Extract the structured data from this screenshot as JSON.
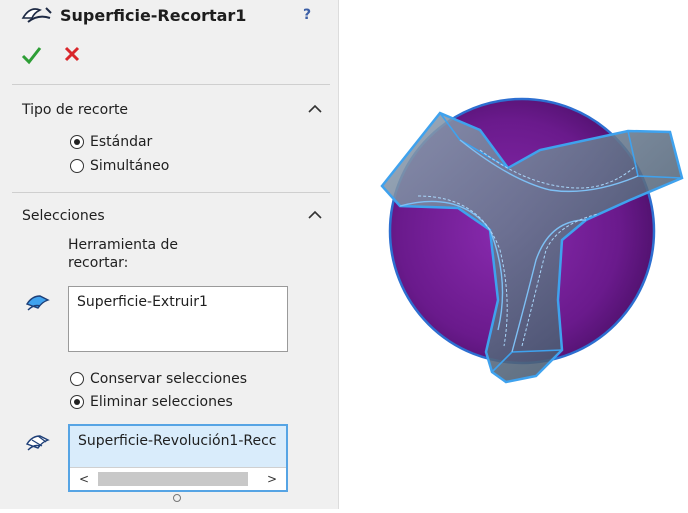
{
  "feature": {
    "title": "Superficie-Recortar1",
    "help_label": "?"
  },
  "trim_type": {
    "heading": "Tipo de recorte",
    "options": [
      {
        "label": "Estándar",
        "selected": true
      },
      {
        "label": "Simultáneo",
        "selected": false
      }
    ]
  },
  "selections": {
    "heading": "Selecciones",
    "trim_tool_label": "Herramienta de recortar:",
    "trim_tool_value": "Superficie-Extruir1",
    "options": [
      {
        "label": "Conservar selecciones",
        "selected": false
      },
      {
        "label": "Eliminar selecciones",
        "selected": true
      }
    ],
    "pieces_value": "Superficie-Revolución1-Recc",
    "scroll_left": "<",
    "scroll_right": ">"
  },
  "colors": {
    "ok": "#2e9e36",
    "cancel": "#d9262b",
    "sphere": "#6a1a8c",
    "highlight": "#3fa2ee",
    "panel_bg": "#f0f0f0"
  }
}
